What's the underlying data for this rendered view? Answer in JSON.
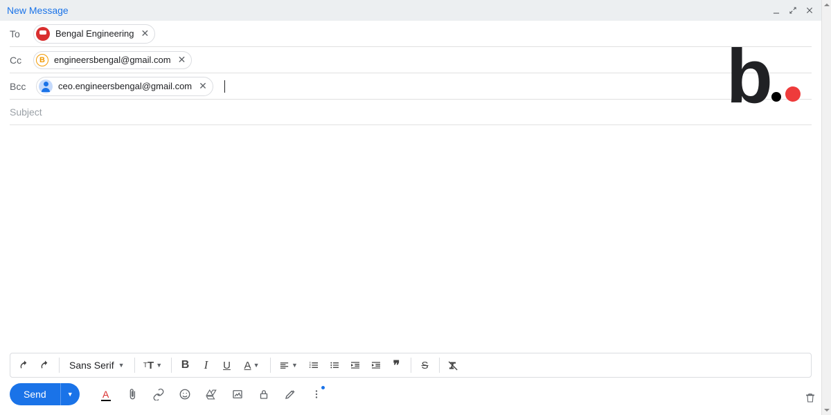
{
  "header": {
    "title": "New Message"
  },
  "recipients": {
    "to_label": "To",
    "cc_label": "Cc",
    "bcc_label": "Bcc",
    "to": {
      "name": "Bengal Engineering"
    },
    "cc": {
      "email": "engineersbengal@gmail.com",
      "avatar_letter": "B"
    },
    "bcc": {
      "email": "ceo.engineersbengal@gmail.com"
    }
  },
  "subject": {
    "placeholder": "Subject",
    "value": ""
  },
  "toolbar": {
    "font": "Sans Serif"
  },
  "actions": {
    "send": "Send"
  },
  "watermark": {
    "letter": "b"
  }
}
